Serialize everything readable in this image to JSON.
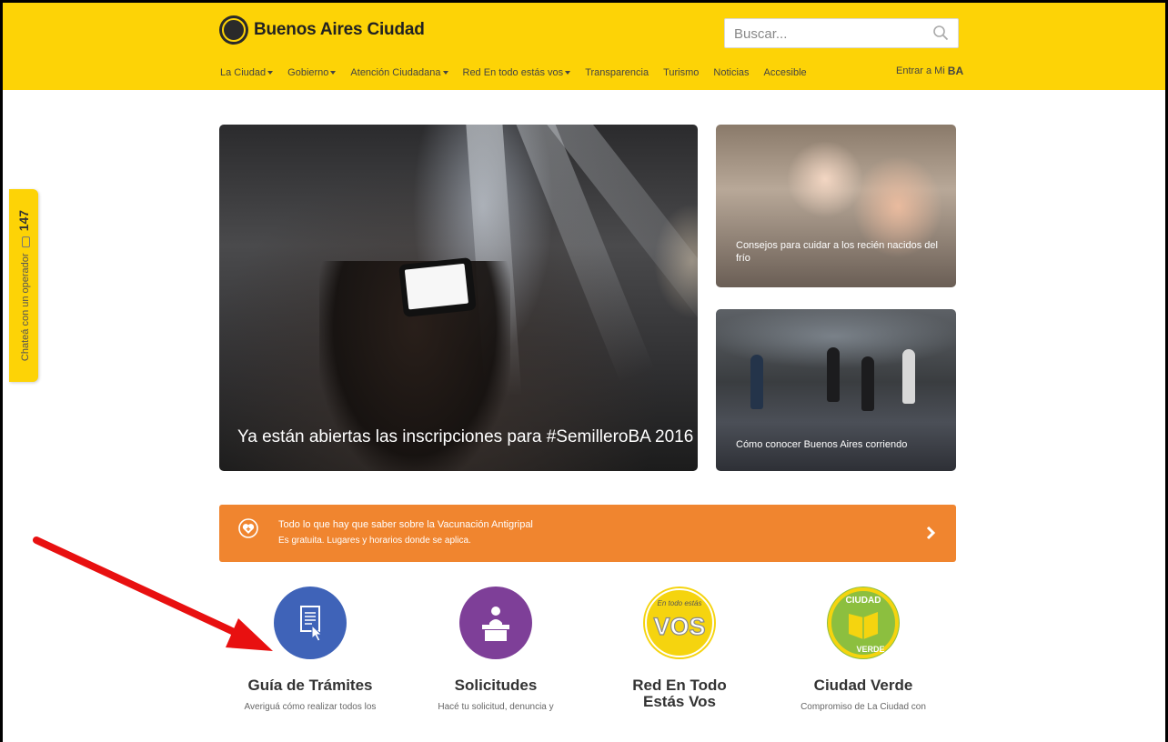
{
  "header": {
    "site_name": "Buenos Aires Ciudad",
    "search_placeholder": "Buscar...",
    "nav": [
      {
        "label": "La Ciudad",
        "dropdown": true
      },
      {
        "label": "Gobierno",
        "dropdown": true
      },
      {
        "label": "Atención Ciudadana",
        "dropdown": true
      },
      {
        "label": "Red En todo estás vos",
        "dropdown": true
      },
      {
        "label": "Transparencia",
        "dropdown": false
      },
      {
        "label": "Turismo",
        "dropdown": false
      },
      {
        "label": "Noticias",
        "dropdown": false
      },
      {
        "label": "Accesible",
        "dropdown": false
      }
    ],
    "login_label": "Entrar a Mi",
    "login_brand": "BA",
    "accent_color": "#fdd306"
  },
  "chat_tab": {
    "label": "Chateá con un operador",
    "number": "147"
  },
  "hero": {
    "main_caption": "Ya están abiertas las inscripciones para #SemilleroBA 2016",
    "side_cards": [
      {
        "caption": "Consejos para cuidar a los recién nacidos del frío"
      },
      {
        "caption": "Cómo conocer Buenos Aires corriendo"
      }
    ]
  },
  "banner": {
    "title": "Todo lo que hay que saber sobre la Vacunación Antigripal",
    "subtitle": "Es gratuita. Lugares y horarios donde se aplica.",
    "color": "#f0852f"
  },
  "features": [
    {
      "title": "Guía de Trámites",
      "desc": "Averiguá cómo realizar todos los",
      "color": "#3f63b8",
      "icon": "document-cursor-icon"
    },
    {
      "title": "Solicitudes",
      "desc": "Hacé tu solicitud, denuncia y",
      "color": "#7e3f98",
      "icon": "podium-icon"
    },
    {
      "title": "Red En Todo Estás Vos",
      "desc": "",
      "color": "#f5d40f",
      "icon": "vos-logo-icon",
      "badge_small": "En todo estás",
      "badge_big": "VOS"
    },
    {
      "title": "Ciudad Verde",
      "desc": "Compromiso de La Ciudad con",
      "color": "#8cbf3f",
      "icon": "ciudad-verde-logo-icon",
      "badge_top": "CIUDAD",
      "badge_bottom": "VERDE"
    }
  ]
}
